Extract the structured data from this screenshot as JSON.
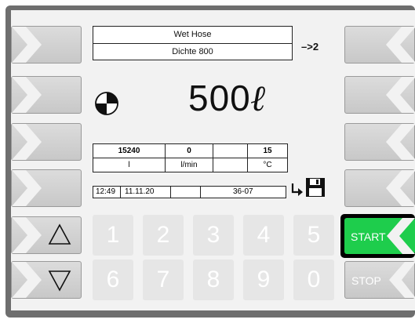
{
  "header": {
    "line1": "Wet Hose",
    "line2": "Dichte 800",
    "step_indicator": "–>2"
  },
  "display": {
    "volume_value": "500",
    "volume_unit": "ℓ"
  },
  "readings": {
    "values": [
      "15240",
      "0",
      "",
      "15"
    ],
    "units": [
      "l",
      "l/min",
      "",
      "°C"
    ]
  },
  "status": {
    "time": "12:49",
    "date": "11.11.20",
    "code": "36-07"
  },
  "keypad": {
    "row1": [
      "1",
      "2",
      "3",
      "4",
      "5"
    ],
    "row2": [
      "6",
      "7",
      "8",
      "9",
      "0"
    ]
  },
  "buttons": {
    "start_label": "START",
    "stop_label": "STOP"
  },
  "colors": {
    "start_green": "#1ecd4c",
    "bezel": "#6e6e6e"
  },
  "icons": [
    "up-arrow-icon",
    "down-arrow-icon",
    "pie-progress-icon",
    "return-arrow-icon",
    "save-floppy-icon",
    "chevron-right-icon",
    "chevron-left-icon"
  ]
}
